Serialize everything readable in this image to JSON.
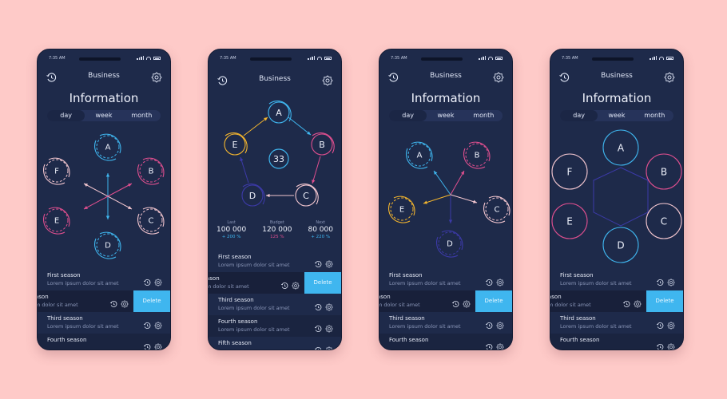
{
  "colors": {
    "background": "#fecac8",
    "phone": "#1e2a4a",
    "blue": "#3fb6ef",
    "pink": "#e04f8f",
    "lightpink": "#f3c6cf",
    "yellow": "#f3b52e",
    "indigo": "#3c3aa8",
    "delete": "#3fb6ef"
  },
  "status": {
    "time": "7:35 AM"
  },
  "header": {
    "title": "Business"
  },
  "info_title": "Information",
  "segments": [
    "day",
    "week",
    "month"
  ],
  "active_segment": "day",
  "nodes_six": [
    "A",
    "B",
    "C",
    "D",
    "E",
    "F"
  ],
  "nodes_five": [
    "A",
    "B",
    "C",
    "D",
    "E"
  ],
  "center_value": "33",
  "stats": [
    {
      "label": "Last",
      "value": "100 000",
      "change": "+ 200 %",
      "color": "#3fb6ef"
    },
    {
      "label": "Budget",
      "value": "120 000",
      "change": "125 %",
      "color": "#e04f8f"
    },
    {
      "label": "Next",
      "value": "80 000",
      "change": "+ 220 %",
      "color": "#3fb6ef"
    }
  ],
  "list": {
    "subtitle": "Lorem ipsum dolor sit amet",
    "swiped_title": "ason",
    "swiped_subtitle": "m dolor sit amet",
    "delete_label": "Delete",
    "items": [
      "First season",
      "Second season",
      "Third season",
      "Fourth season",
      "Fifth season"
    ]
  },
  "phones": [
    {
      "variant": "arrows-six"
    },
    {
      "variant": "cycle-five"
    },
    {
      "variant": "radial-five"
    },
    {
      "variant": "hexagon-six"
    }
  ]
}
